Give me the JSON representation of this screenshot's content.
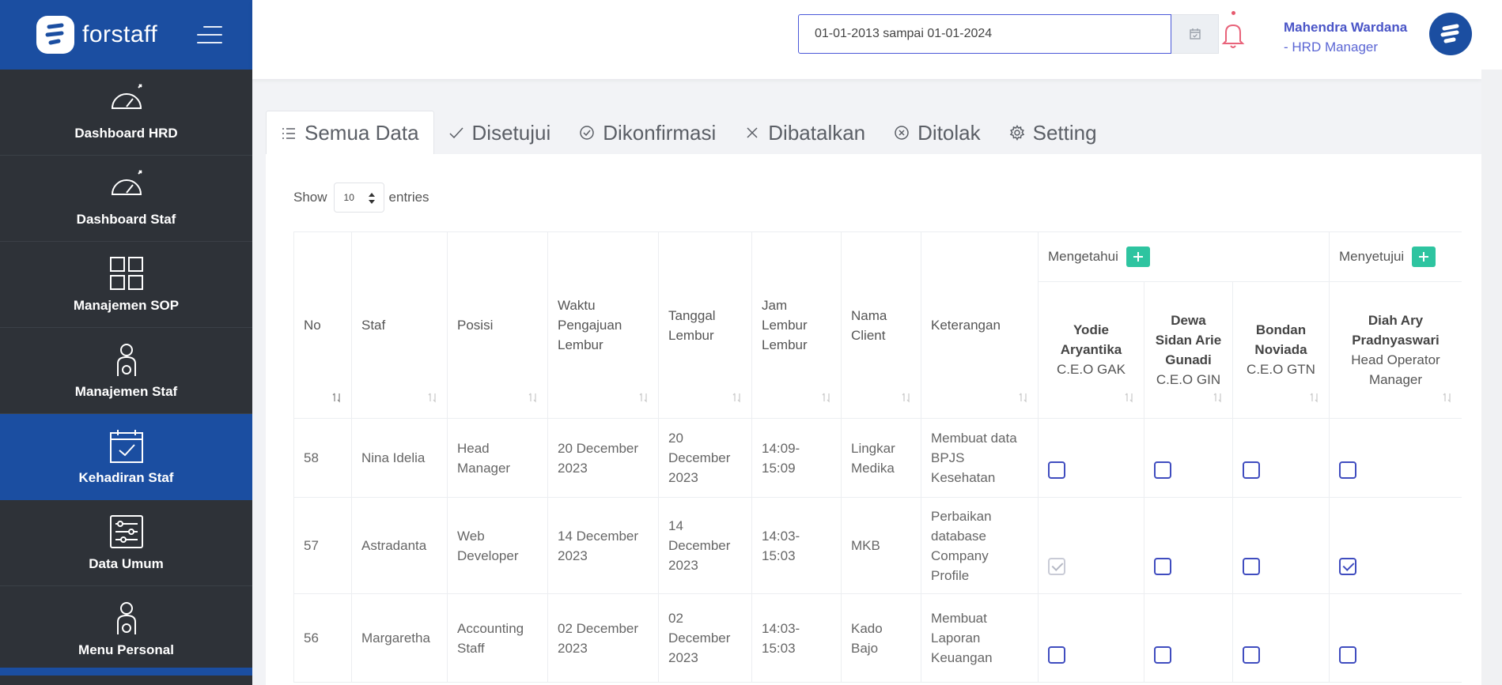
{
  "brand": {
    "name": "forstaff"
  },
  "sidebar": {
    "items": [
      {
        "label": "Dashboard HRD",
        "icon": "speedometer-icon",
        "active": false
      },
      {
        "label": "Dashboard Staf",
        "icon": "speedometer-icon",
        "active": false
      },
      {
        "label": "Manajemen SOP",
        "icon": "grid-icon",
        "active": false
      },
      {
        "label": "Manajemen Staf",
        "icon": "user-gear-icon",
        "active": false
      },
      {
        "label": "Kehadiran Staf",
        "icon": "calendar-check-icon",
        "active": true
      },
      {
        "label": "Data Umum",
        "icon": "sliders-icon",
        "active": false
      },
      {
        "label": "Menu Personal",
        "icon": "user-gear-icon",
        "active": false
      }
    ]
  },
  "topbar": {
    "date_range_value": "01-01-2013 sampai 01-01-2024",
    "user_name": "Mahendra Wardana",
    "user_role": "- HRD Manager"
  },
  "tabs": [
    {
      "label": "Semua Data",
      "icon": "list-icon",
      "active": true
    },
    {
      "label": "Disetujui",
      "icon": "check-icon",
      "active": false
    },
    {
      "label": "Dikonfirmasi",
      "icon": "check-circle-icon",
      "active": false
    },
    {
      "label": "Dibatalkan",
      "icon": "x-icon",
      "active": false
    },
    {
      "label": "Ditolak",
      "icon": "x-circle-icon",
      "active": false
    },
    {
      "label": "Setting",
      "icon": "gear-icon",
      "active": false
    }
  ],
  "entries": {
    "show_label": "Show",
    "value": "10",
    "suffix": "entries"
  },
  "table": {
    "headers": {
      "no": "No",
      "staf": "Staf",
      "posisi": "Posisi",
      "waktu": "Waktu Pengajuan Lembur",
      "tanggal": "Tanggal Lembur",
      "jam": "Jam Lembur Lembur",
      "client": "Nama Client",
      "keterangan": "Keterangan",
      "mengetahui": "Mengetahui",
      "menyetujui": "Menyetujui"
    },
    "approvers": [
      {
        "name": "Yodie Aryantika",
        "title": "C.E.O GAK"
      },
      {
        "name": "Dewa Sidan Arie Gunadi",
        "title": "C.E.O GIN"
      },
      {
        "name": "Bondan Noviada",
        "title": "C.E.O GTN"
      },
      {
        "name": "Diah Ary Pradnyaswari",
        "title": "Head Operator Manager"
      }
    ],
    "rows": [
      {
        "no": "58",
        "staf": "Nina Idelia",
        "posisi": "Head Manager",
        "waktu": "20 December 2023",
        "tanggal": "20 December 2023",
        "jam": "14:09-15:09",
        "client": "Lingkar Medika",
        "keterangan": "Membuat data BPJS Kesehatan",
        "checks": [
          false,
          false,
          false,
          false
        ],
        "disabled": [
          false,
          false,
          false,
          false
        ]
      },
      {
        "no": "57",
        "staf": "Astradanta",
        "posisi": "Web Developer",
        "waktu": "14 December 2023",
        "tanggal": "14 December 2023",
        "jam": "14:03-15:03",
        "client": "MKB",
        "keterangan": "Perbaikan database Company Profile",
        "checks": [
          true,
          false,
          false,
          true
        ],
        "disabled": [
          true,
          false,
          false,
          false
        ]
      },
      {
        "no": "56",
        "staf": "Margaretha",
        "posisi": "Accounting Staff",
        "waktu": "02 December 2023",
        "tanggal": "02 December 2023",
        "jam": "14:03-15:03",
        "client": "Kado Bajo",
        "keterangan": "Membuat Laporan Keuangan",
        "checks": [
          false,
          false,
          false,
          false
        ],
        "disabled": [
          false,
          false,
          false,
          false
        ]
      }
    ]
  },
  "colors": {
    "primary": "#1b4ea1",
    "sidebar_bg": "#2e3238",
    "accent": "#4a55c7",
    "add_button": "#2ec4a0"
  }
}
